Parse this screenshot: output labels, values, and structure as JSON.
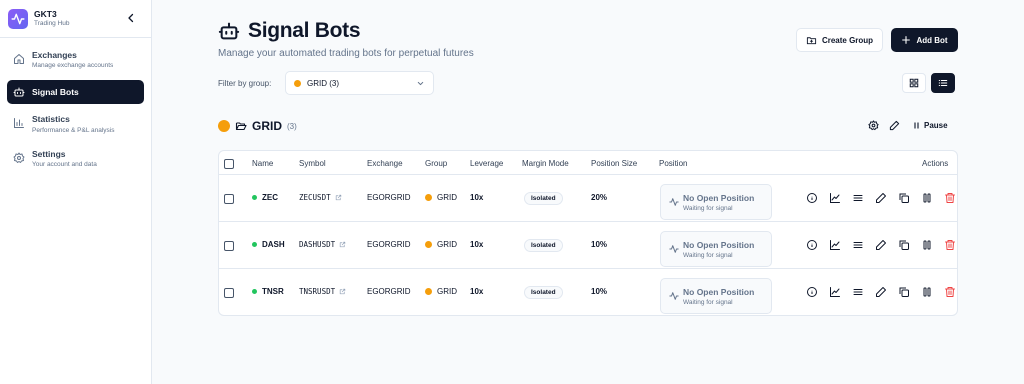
{
  "brand": {
    "name": "GKT3",
    "sub": "Trading Hub"
  },
  "nav": [
    {
      "label": "Exchanges",
      "sub": "Manage exchange accounts",
      "icon": "home-icon",
      "active": false
    },
    {
      "label": "Signal Bots",
      "sub": "",
      "icon": "bot-icon",
      "active": true
    },
    {
      "label": "Statistics",
      "sub": "Performance & P&L analysis",
      "icon": "chart-icon",
      "active": false
    },
    {
      "label": "Settings",
      "sub": "Your account and data",
      "icon": "gear-icon",
      "active": false
    }
  ],
  "page": {
    "title": "Signal Bots",
    "subtitle": "Manage your automated trading bots for perpetual futures",
    "create_group": "Create Group",
    "add_bot": "Add Bot",
    "filter_label": "Filter by group:",
    "filter_value": "GRID (3)"
  },
  "group": {
    "name": "GRID",
    "count": "(3)",
    "pause": "Pause",
    "color": "#f59e0b"
  },
  "table": {
    "headers": {
      "name": "Name",
      "symbol": "Symbol",
      "exchange": "Exchange",
      "group": "Group",
      "leverage": "Leverage",
      "margin": "Margin Mode",
      "size": "Position Size",
      "position": "Position",
      "actions": "Actions"
    },
    "rows": [
      {
        "name": "ZEC",
        "symbol": "ZECUSDT",
        "exchange": "EGORGRID",
        "group": "GRID",
        "leverage": "10x",
        "margin": "Isolated",
        "size": "20%",
        "position_title": "No Open Position",
        "position_sub": "Waiting for signal"
      },
      {
        "name": "DASH",
        "symbol": "DASHUSDT",
        "exchange": "EGORGRID",
        "group": "GRID",
        "leverage": "10x",
        "margin": "Isolated",
        "size": "10%",
        "position_title": "No Open Position",
        "position_sub": "Waiting for signal"
      },
      {
        "name": "TNSR",
        "symbol": "TNSRUSDT",
        "exchange": "EGORGRID",
        "group": "GRID",
        "leverage": "10x",
        "margin": "Isolated",
        "size": "10%",
        "position_title": "No Open Position",
        "position_sub": "Waiting for signal"
      }
    ]
  },
  "colors": {
    "accent": "#0f172a",
    "status_active": "#22c55e",
    "group": "#f59e0b",
    "delete": "#ef4444"
  }
}
